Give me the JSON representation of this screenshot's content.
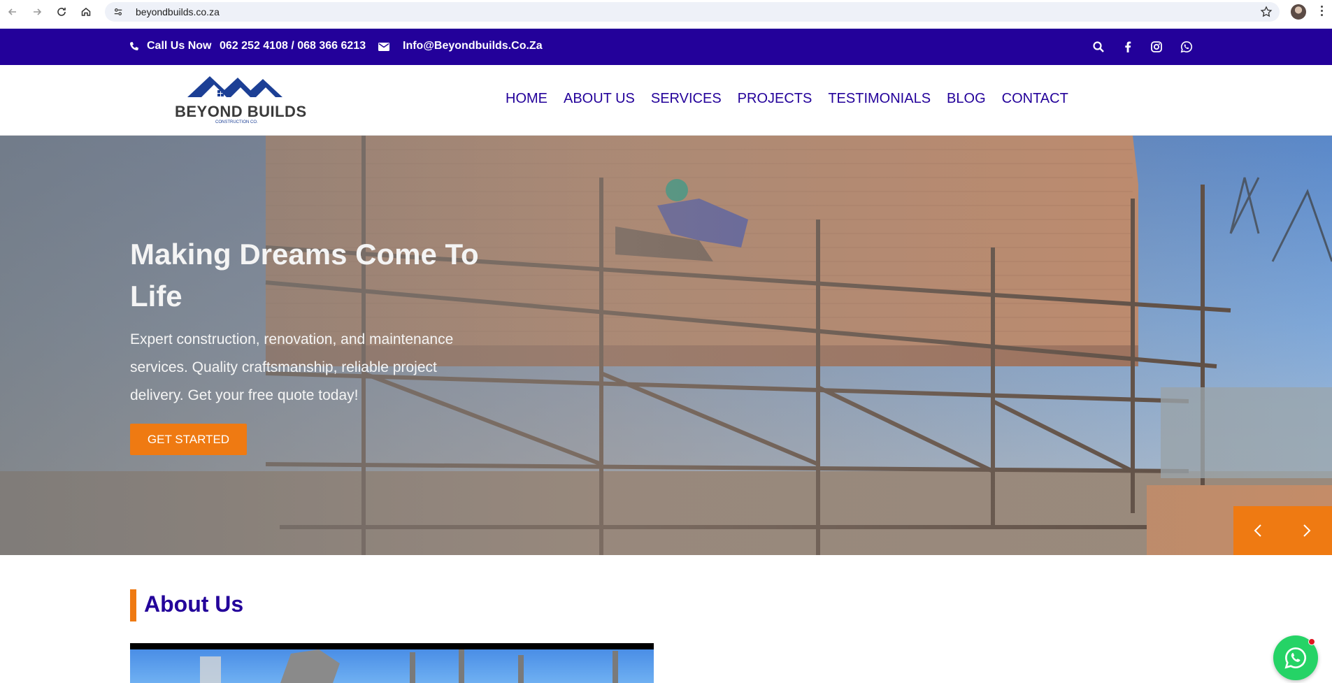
{
  "browser": {
    "url": "beyondbuilds.co.za",
    "icons": [
      "back-arrow-icon",
      "forward-arrow-icon",
      "reload-icon",
      "home-icon",
      "site-info-icon",
      "bookmark-star-icon",
      "profile-avatar",
      "more-menu-icon"
    ]
  },
  "topbar": {
    "call_label": "Call Us Now",
    "phone": "062 252 4108 / 068 366 6213",
    "email": "Info@Beyondbuilds.Co.Za",
    "bg_color": "#23019a",
    "social_icons": [
      "search-icon",
      "facebook-icon",
      "instagram-icon",
      "whatsapp-icon"
    ]
  },
  "header": {
    "logo_name": "BEYOND BUILDS",
    "logo_sub": "CONSTRUCTION CO.",
    "nav": [
      "HOME",
      "ABOUT US",
      "SERVICES",
      "PROJECTS",
      "TESTIMONIALS",
      "BLOG",
      "CONTACT"
    ],
    "nav_color": "#23019a"
  },
  "hero": {
    "title": "Making Dreams Come To Life",
    "description": "Expert construction, renovation, and maintenance services. Quality craftsmanship, reliable project delivery. Get your free quote today!",
    "cta": "GET STARTED",
    "accent": "#ef7a12",
    "arrows": [
      "chevron-left-icon",
      "chevron-right-icon"
    ]
  },
  "about": {
    "title": "About Us"
  },
  "floating": {
    "icon": "whatsapp-chat-icon",
    "color": "#25d366"
  }
}
